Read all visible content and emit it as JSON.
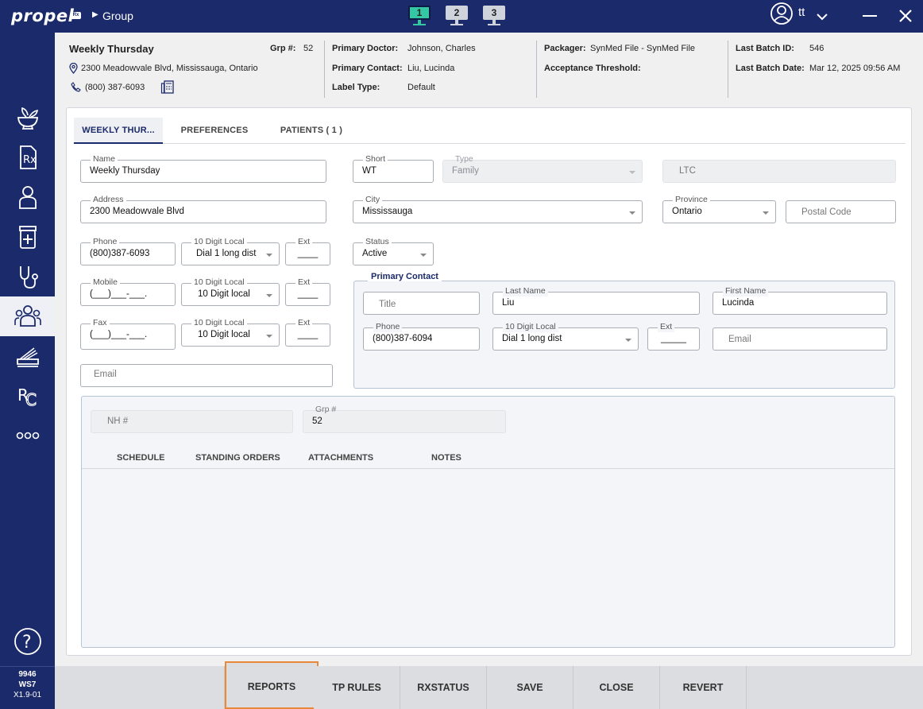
{
  "topbar": {
    "logo": "propel",
    "logo_badge": "Rx",
    "breadcrumb": "Group",
    "workspaces": [
      "1",
      "2",
      "3"
    ],
    "user": "tt"
  },
  "sidebar": {
    "items": [
      "mortar-pestle-icon",
      "prescription-icon",
      "patient-icon",
      "pill-bottle-icon",
      "stethoscope-icon",
      "group-icon",
      "packaging-icon",
      "rc-icon",
      "more-icon"
    ],
    "help": "?",
    "store_number": "9946",
    "workstation": "WS7",
    "version": "X1.9-01"
  },
  "header": {
    "group_name": "Weekly Thursday",
    "grp_label": "Grp #:",
    "grp_value": "52",
    "address": "2300 Meadowvale Blvd, Mississauga, Ontario",
    "phone": "(800) 387-6093",
    "primary_doctor_label": "Primary Doctor:",
    "primary_doctor": "Johnson, Charles",
    "primary_contact_label": "Primary Contact:",
    "primary_contact": "Liu, Lucinda",
    "label_type_label": "Label Type:",
    "label_type": "Default",
    "packager_label": "Packager:",
    "packager": "SynMed File - SynMed File",
    "acceptance_label": "Acceptance Threshold:",
    "last_batch_id_label": "Last Batch ID:",
    "last_batch_id": "546",
    "last_batch_date_label": "Last Batch Date:",
    "last_batch_date": "Mar 12, 2025 09:56 AM"
  },
  "tabs": [
    "WEEKLY THUR...",
    "PREFERENCES",
    "PATIENTS ( 1 )"
  ],
  "form": {
    "name_label": "Name",
    "name": "Weekly Thursday",
    "short_label": "Short",
    "short": "WT",
    "type_label": "Type",
    "type": "Family",
    "ltc": "LTC",
    "address_label": "Address",
    "address": "2300 Meadowvale Blvd",
    "city_label": "City",
    "city": "Mississauga",
    "province_label": "Province",
    "province": "Ontario",
    "postal_placeholder": "Postal Code",
    "phone_label": "Phone",
    "phone": "(800)387-6093",
    "phone_local_label": "10 Digit Local",
    "phone_local": "Dial 1 long dist",
    "ext_label": "Ext",
    "phone_ext": "____",
    "status_label": "Status",
    "status": "Active",
    "mobile_label": "Mobile",
    "mobile": "(___)___-___.",
    "mobile_local_label": "10 Digit Local",
    "mobile_local": "10 Digit local",
    "mobile_ext": "____",
    "fax_label": "Fax",
    "fax": "(___)___-___.",
    "fax_local_label": "10 Digit Local",
    "fax_local": "10 Digit local",
    "fax_ext": "____",
    "email_placeholder": "Email"
  },
  "primary_contact": {
    "title": "Primary Contact",
    "title_placeholder": "Title",
    "last_name_label": "Last Name",
    "last_name": "Liu",
    "first_name_label": "First Name",
    "first_name": "Lucinda",
    "phone_label": "Phone",
    "phone": "(800)387-6094",
    "local_label": "10 Digit Local",
    "local": "Dial 1 long dist",
    "ext_label": "Ext",
    "ext": "_____",
    "email_placeholder": "Email"
  },
  "lower": {
    "nh_placeholder": "NH #",
    "grp_label": "Grp #",
    "grp_value": "52",
    "tabs": [
      "SCHEDULE",
      "STANDING ORDERS",
      "ATTACHMENTS",
      "NOTES"
    ]
  },
  "footer": {
    "buttons": [
      "REPORTS",
      "TP RULES",
      "RXSTATUS",
      "SAVE",
      "CLOSE",
      "REVERT"
    ]
  },
  "colors": {
    "navy": "#1b2a6b",
    "teal": "#35c6a4",
    "highlight": "#e8893a"
  }
}
